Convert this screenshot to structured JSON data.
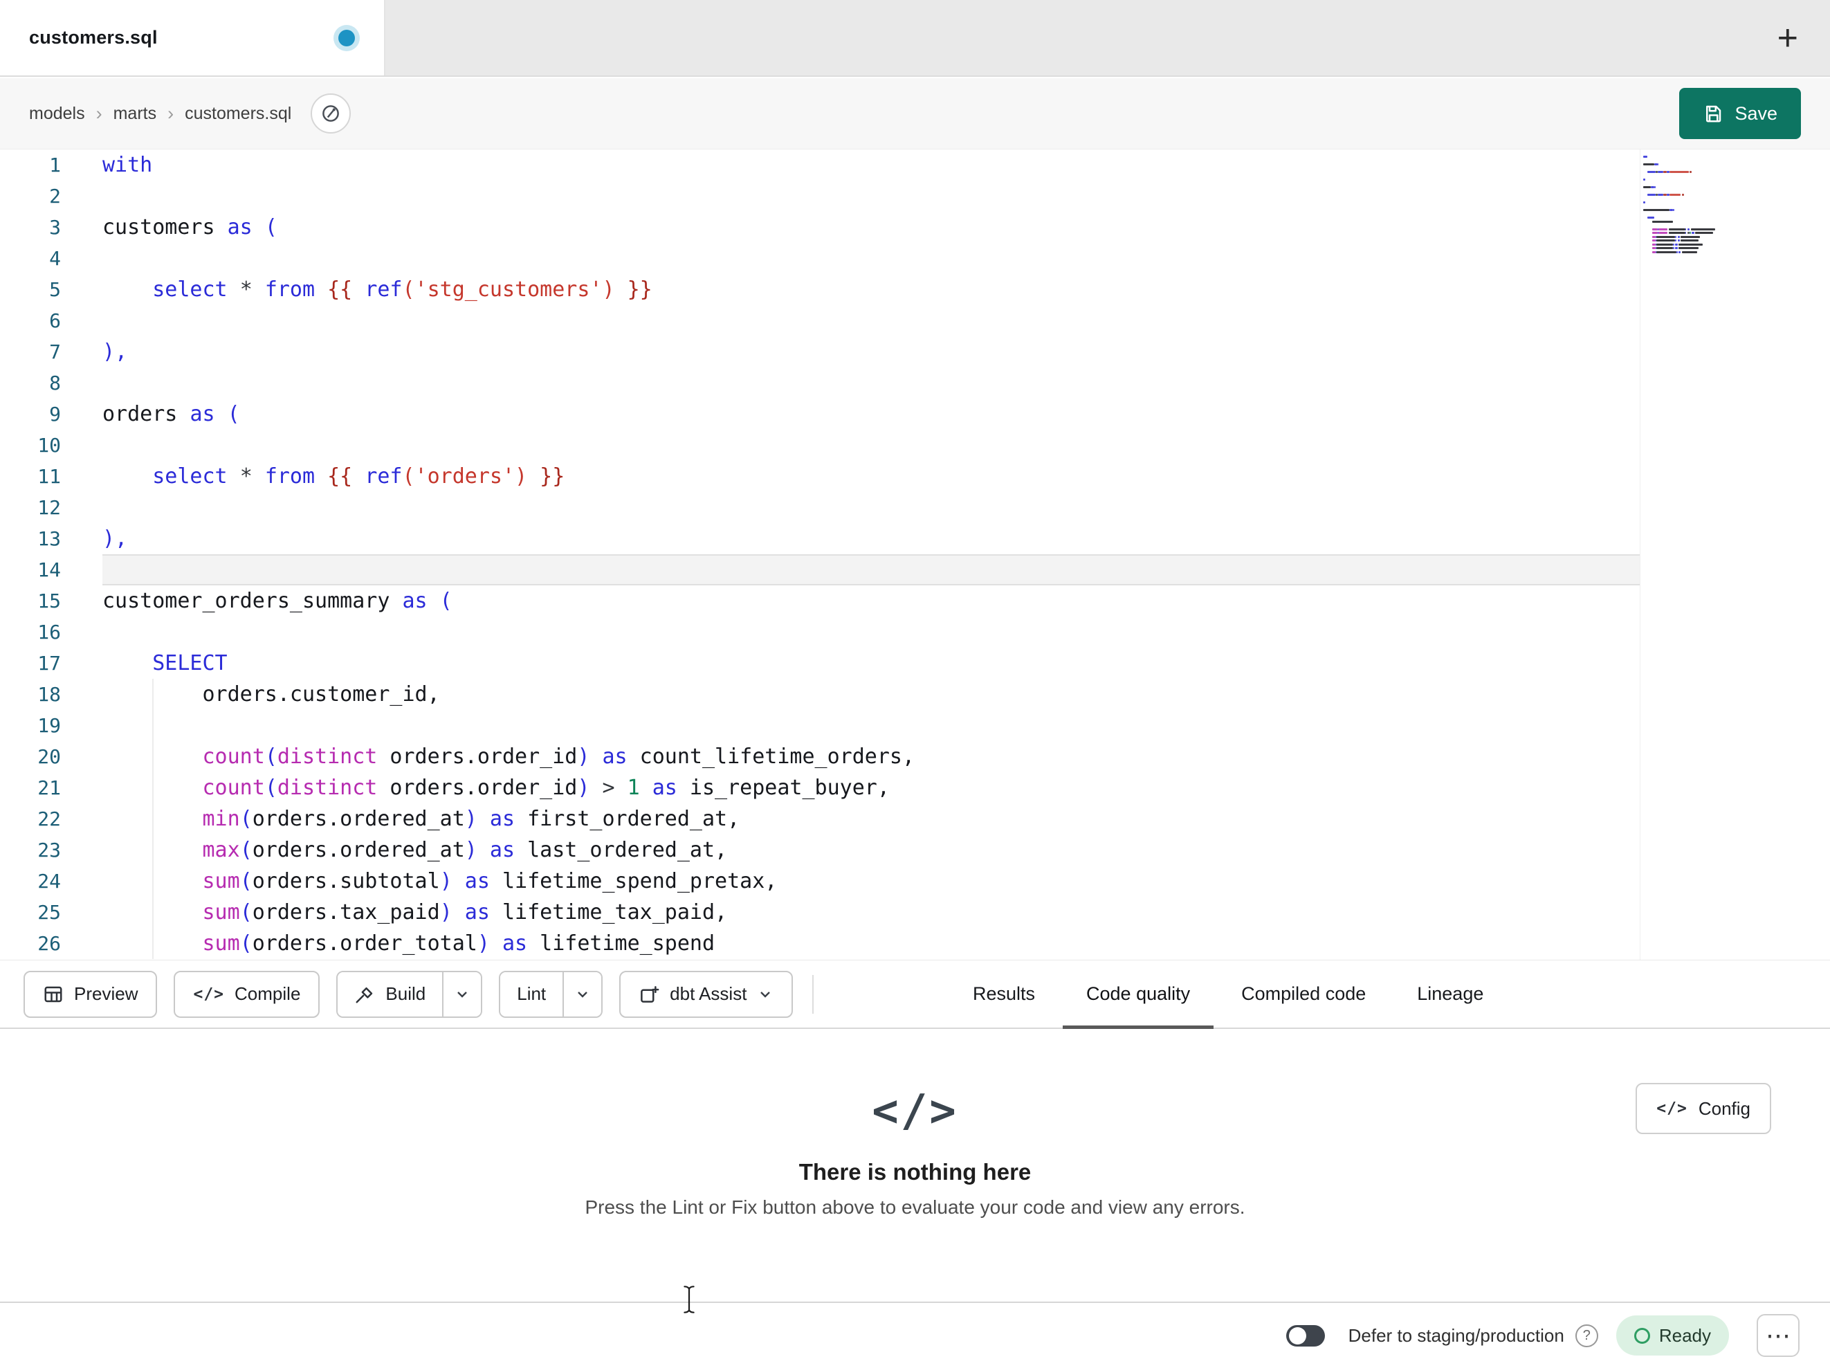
{
  "window": {
    "active_tab": "customers.sql",
    "new_tab_label": "+"
  },
  "breadcrumb": {
    "items": [
      "models",
      "marts",
      "customers.sql"
    ],
    "separator": "›"
  },
  "save": {
    "label": "Save"
  },
  "icons": {
    "code_glyph": "</>",
    "more_glyph": "⋯",
    "help_glyph": "?"
  },
  "editor": {
    "current_line": 14,
    "lines": [
      {
        "n": 1,
        "t": [
          [
            "kw",
            "with"
          ]
        ]
      },
      {
        "n": 2,
        "t": []
      },
      {
        "n": 3,
        "t": [
          [
            "id",
            "customers "
          ],
          [
            "kw",
            "as "
          ],
          [
            "pn",
            "("
          ]
        ]
      },
      {
        "n": 4,
        "t": []
      },
      {
        "n": 5,
        "t": [
          [
            "id",
            "    "
          ],
          [
            "kw",
            "select "
          ],
          [
            "op",
            "* "
          ],
          [
            "kw",
            "from "
          ],
          [
            "jj",
            "{{ "
          ],
          [
            "kw",
            "ref"
          ],
          [
            "st",
            "('stg_customers')"
          ],
          [
            "jj",
            " }}"
          ]
        ]
      },
      {
        "n": 6,
        "t": []
      },
      {
        "n": 7,
        "t": [
          [
            "pn",
            "),"
          ]
        ]
      },
      {
        "n": 8,
        "t": []
      },
      {
        "n": 9,
        "t": [
          [
            "id",
            "orders "
          ],
          [
            "kw",
            "as "
          ],
          [
            "pn",
            "("
          ]
        ]
      },
      {
        "n": 10,
        "t": []
      },
      {
        "n": 11,
        "t": [
          [
            "id",
            "    "
          ],
          [
            "kw",
            "select "
          ],
          [
            "op",
            "* "
          ],
          [
            "kw",
            "from "
          ],
          [
            "jj",
            "{{ "
          ],
          [
            "kw",
            "ref"
          ],
          [
            "st",
            "('orders')"
          ],
          [
            "jj",
            " }}"
          ]
        ]
      },
      {
        "n": 12,
        "t": []
      },
      {
        "n": 13,
        "t": [
          [
            "pn",
            "),"
          ]
        ]
      },
      {
        "n": 14,
        "t": []
      },
      {
        "n": 15,
        "t": [
          [
            "id",
            "customer_orders_summary "
          ],
          [
            "kw",
            "as "
          ],
          [
            "pn",
            "("
          ]
        ]
      },
      {
        "n": 16,
        "t": []
      },
      {
        "n": 17,
        "t": [
          [
            "id",
            "    "
          ],
          [
            "kw",
            "SELECT"
          ]
        ]
      },
      {
        "n": 18,
        "t": [
          [
            "id",
            "        orders.customer_id,"
          ]
        ]
      },
      {
        "n": 19,
        "t": []
      },
      {
        "n": 20,
        "t": [
          [
            "id",
            "        "
          ],
          [
            "fn",
            "count"
          ],
          [
            "pn",
            "("
          ],
          [
            "fn",
            "distinct"
          ],
          [
            "id",
            " orders.order_id"
          ],
          [
            "pn",
            ")"
          ],
          [
            "kw",
            " as"
          ],
          [
            "id",
            " count_lifetime_orders,"
          ]
        ]
      },
      {
        "n": 21,
        "t": [
          [
            "id",
            "        "
          ],
          [
            "fn",
            "count"
          ],
          [
            "pn",
            "("
          ],
          [
            "fn",
            "distinct"
          ],
          [
            "id",
            " orders.order_id"
          ],
          [
            "pn",
            ")"
          ],
          [
            "op",
            " > "
          ],
          [
            "nm",
            "1"
          ],
          [
            "kw",
            " as"
          ],
          [
            "id",
            " is_repeat_buyer,"
          ]
        ]
      },
      {
        "n": 22,
        "t": [
          [
            "id",
            "        "
          ],
          [
            "fn",
            "min"
          ],
          [
            "pn",
            "("
          ],
          [
            "id",
            "orders.ordered_at"
          ],
          [
            "pn",
            ")"
          ],
          [
            "kw",
            " as"
          ],
          [
            "id",
            " first_ordered_at,"
          ]
        ]
      },
      {
        "n": 23,
        "t": [
          [
            "id",
            "        "
          ],
          [
            "fn",
            "max"
          ],
          [
            "pn",
            "("
          ],
          [
            "id",
            "orders.ordered_at"
          ],
          [
            "pn",
            ")"
          ],
          [
            "kw",
            " as"
          ],
          [
            "id",
            " last_ordered_at,"
          ]
        ]
      },
      {
        "n": 24,
        "t": [
          [
            "id",
            "        "
          ],
          [
            "fn",
            "sum"
          ],
          [
            "pn",
            "("
          ],
          [
            "id",
            "orders.subtotal"
          ],
          [
            "pn",
            ")"
          ],
          [
            "kw",
            " as"
          ],
          [
            "id",
            " lifetime_spend_pretax,"
          ]
        ]
      },
      {
        "n": 25,
        "t": [
          [
            "id",
            "        "
          ],
          [
            "fn",
            "sum"
          ],
          [
            "pn",
            "("
          ],
          [
            "id",
            "orders.tax_paid"
          ],
          [
            "pn",
            ")"
          ],
          [
            "kw",
            " as"
          ],
          [
            "id",
            " lifetime_tax_paid,"
          ]
        ]
      },
      {
        "n": 26,
        "t": [
          [
            "id",
            "        "
          ],
          [
            "fn",
            "sum"
          ],
          [
            "pn",
            "("
          ],
          [
            "id",
            "orders.order_total"
          ],
          [
            "pn",
            ")"
          ],
          [
            "kw",
            " as"
          ],
          [
            "id",
            " lifetime_spend"
          ]
        ]
      }
    ]
  },
  "toolbar": {
    "preview_label": "Preview",
    "compile_label": "Compile",
    "build_label": "Build",
    "lint_label": "Lint",
    "assist_label": "dbt Assist"
  },
  "result_tabs": [
    {
      "label": "Results",
      "active": false
    },
    {
      "label": "Code quality",
      "active": true
    },
    {
      "label": "Compiled code",
      "active": false
    },
    {
      "label": "Lineage",
      "active": false
    }
  ],
  "empty_state": {
    "icon": "</>",
    "title": "There is nothing here",
    "subtitle": "Press the Lint or Fix button above to evaluate your code and view any errors.",
    "config_label": "Config"
  },
  "status_bar": {
    "defer_label": "Defer to staging/production",
    "ready_label": "Ready"
  },
  "colors": {
    "accent_save": "#0D7562",
    "tab_dot": "#1D93C4",
    "tab_dot_ring": "#C9E7F2",
    "underline": "#595959",
    "ready_bg": "#DCF1E3",
    "ready_icon": "#2F9E63",
    "kw": "#2B2BD8",
    "pn": "#2B2BD8",
    "st": "#C5372C",
    "jj": "#A8271C",
    "fn": "#B62BB0",
    "nm": "#0E8458",
    "op": "#33363B",
    "id": "#16181D",
    "ln": "#1C5E77",
    "cur_line_bg": "#F3F3F3",
    "cur_line_border": "#E0E0E0"
  }
}
